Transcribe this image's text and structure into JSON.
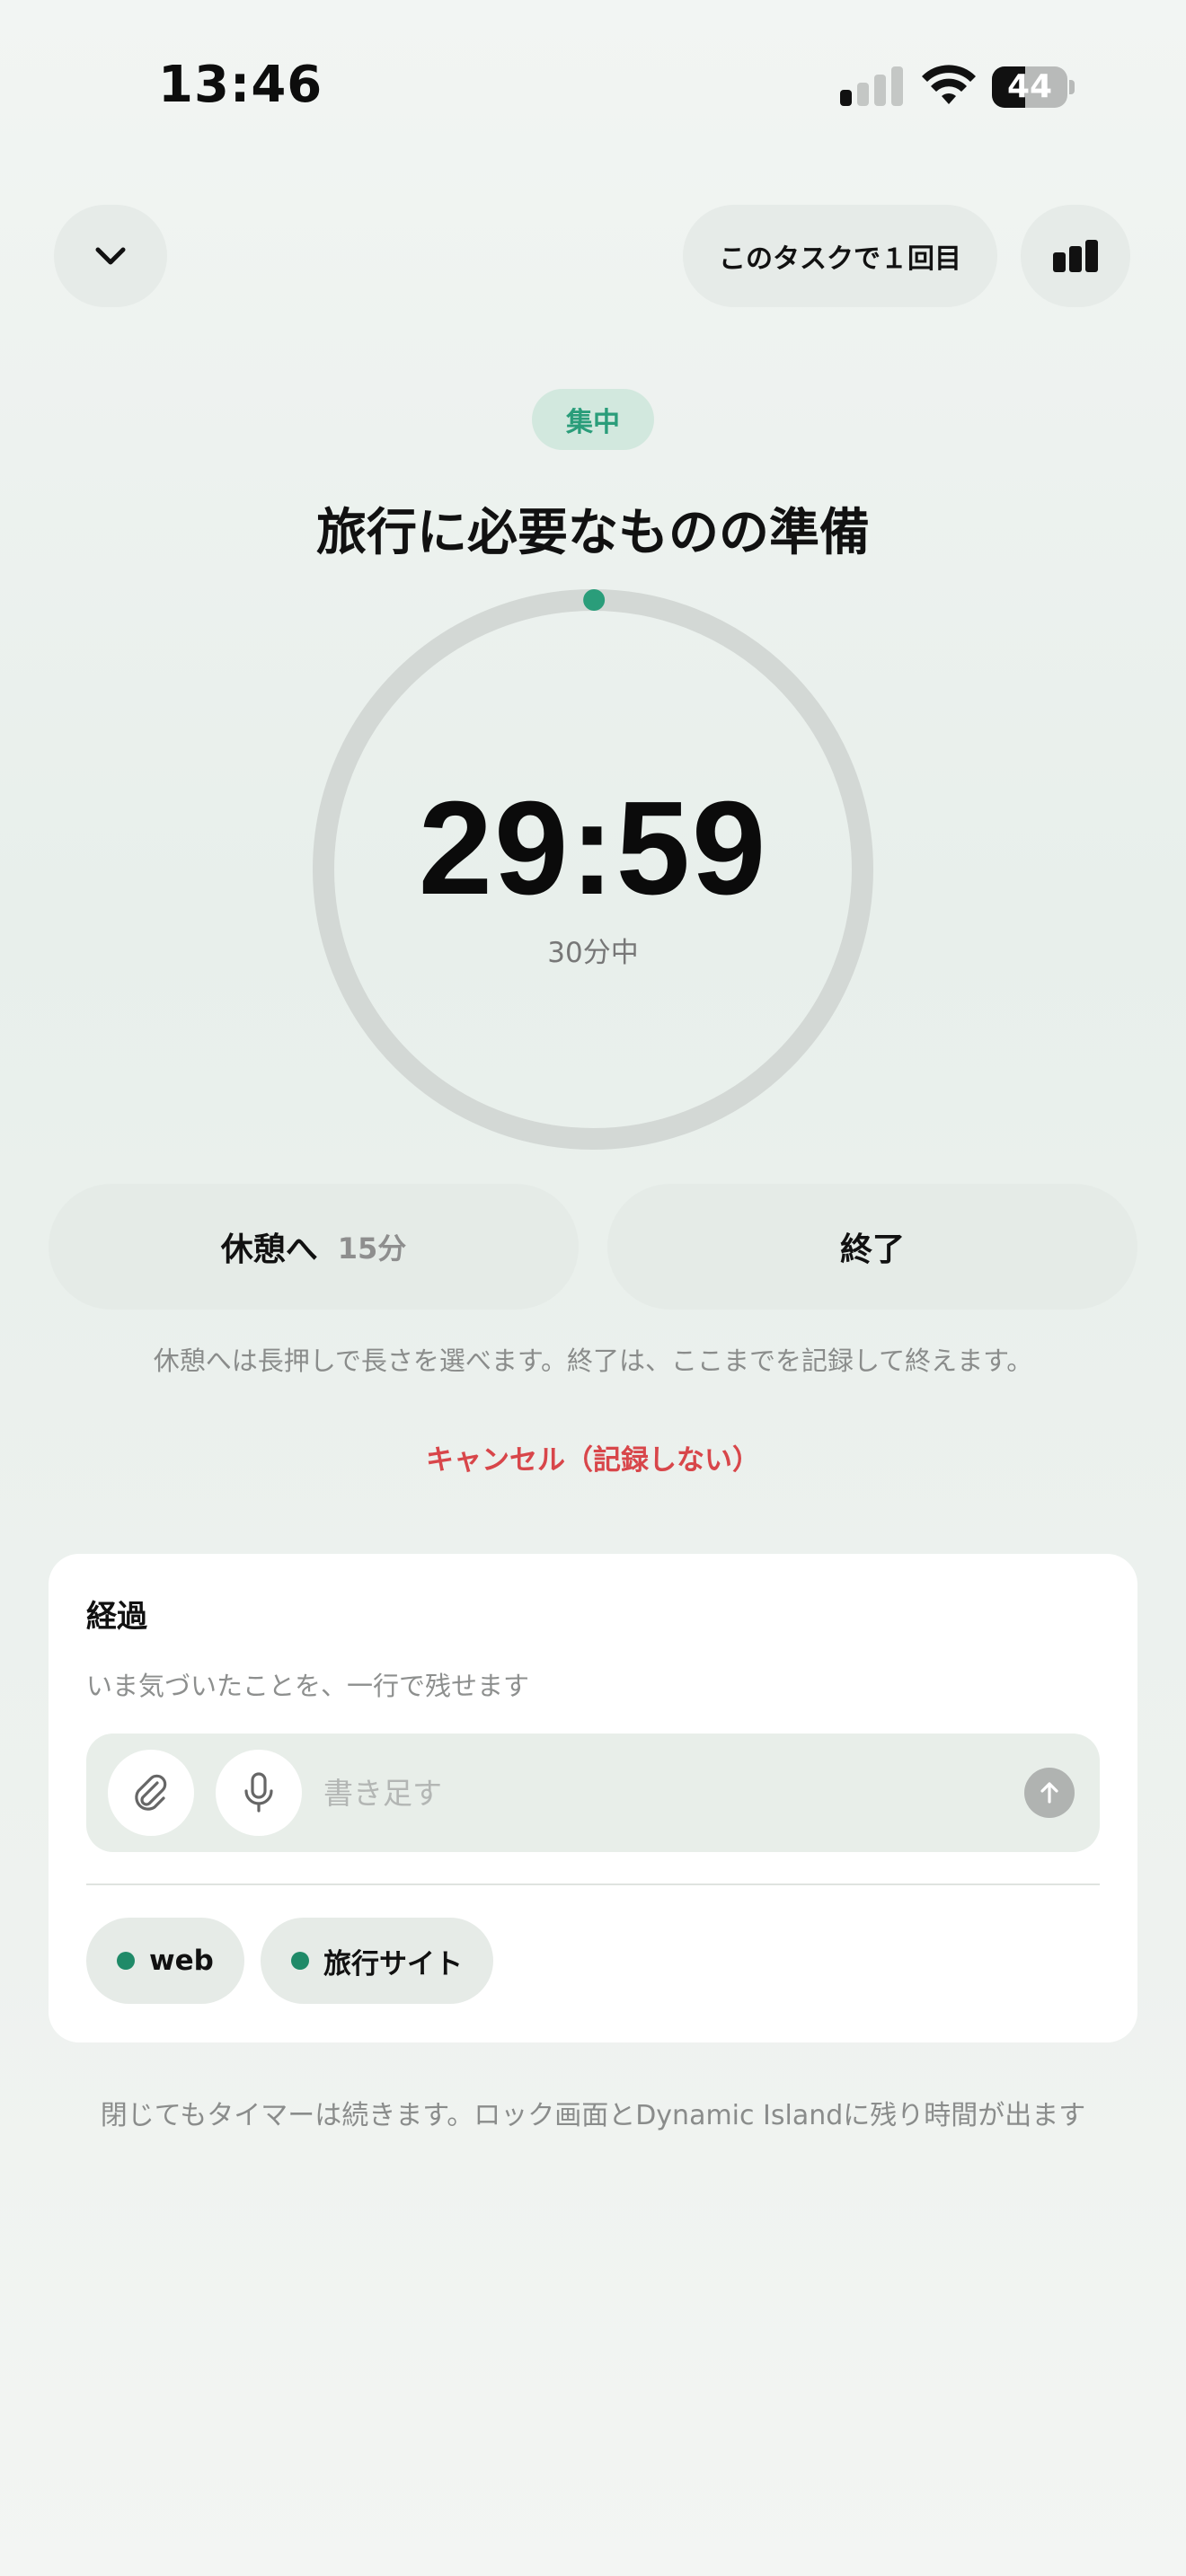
{
  "status_bar": {
    "time": "13:46",
    "battery_level": "44",
    "battery_fraction": 0.44,
    "signal_bars_active": 1,
    "signal_bars_total": 4
  },
  "header": {
    "collapse_icon": "chevron-down-icon",
    "session_label": "このタスクで１回目",
    "stats_icon": "bar-chart-icon"
  },
  "mode": {
    "label": "集中",
    "color": "#2a9d7a"
  },
  "task": {
    "title": "旅行に必要なものの準備"
  },
  "timer": {
    "remaining": "29:59",
    "total_label": "30分中",
    "progress_fraction": 0.0006,
    "ring_color": "#d3d8d5",
    "progress_color": "#2a9d7a"
  },
  "actions": {
    "break_label": "休憩へ",
    "break_minutes": "15分",
    "end_label": "終了",
    "hint": "休憩へは長押しで長さを選べます。終了は、ここまでを記録して終えます。",
    "cancel_label": "キャンセル（記録しない）",
    "cancel_color": "#d8464a"
  },
  "progress_card": {
    "title": "経過",
    "subtitle": "いま気づいたことを、一行で残せます",
    "input_placeholder": "書き足す",
    "attach_icon": "paperclip-icon",
    "mic_icon": "microphone-icon",
    "send_icon": "arrow-up-icon",
    "tags": [
      {
        "label": "web",
        "color": "#1f8a68"
      },
      {
        "label": "旅行サイト",
        "color": "#1f8a68"
      }
    ]
  },
  "footer_note": "閉じてもタイマーは続きます。ロック画面とDynamic Islandに残り時間が出ます"
}
